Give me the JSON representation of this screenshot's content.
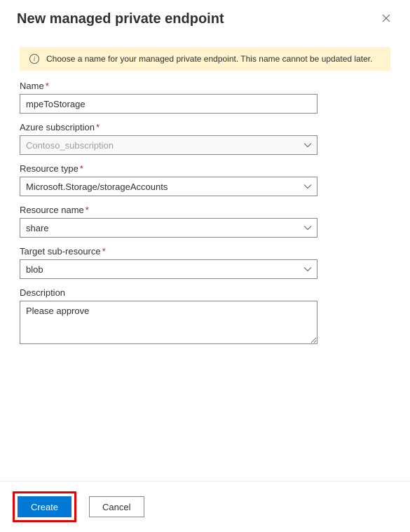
{
  "header": {
    "title": "New managed private endpoint"
  },
  "banner": {
    "text": "Choose a name for your managed private endpoint. This name cannot be updated later."
  },
  "form": {
    "name": {
      "label": "Name",
      "value": "mpeToStorage"
    },
    "subscription": {
      "label": "Azure subscription",
      "value": "Contoso_subscription"
    },
    "resourceType": {
      "label": "Resource type",
      "value": "Microsoft.Storage/storageAccounts"
    },
    "resourceName": {
      "label": "Resource name",
      "value": "share"
    },
    "targetSubResource": {
      "label": "Target sub-resource",
      "value": "blob"
    },
    "description": {
      "label": "Description",
      "value": "Please approve"
    }
  },
  "footer": {
    "create": "Create",
    "cancel": "Cancel"
  }
}
